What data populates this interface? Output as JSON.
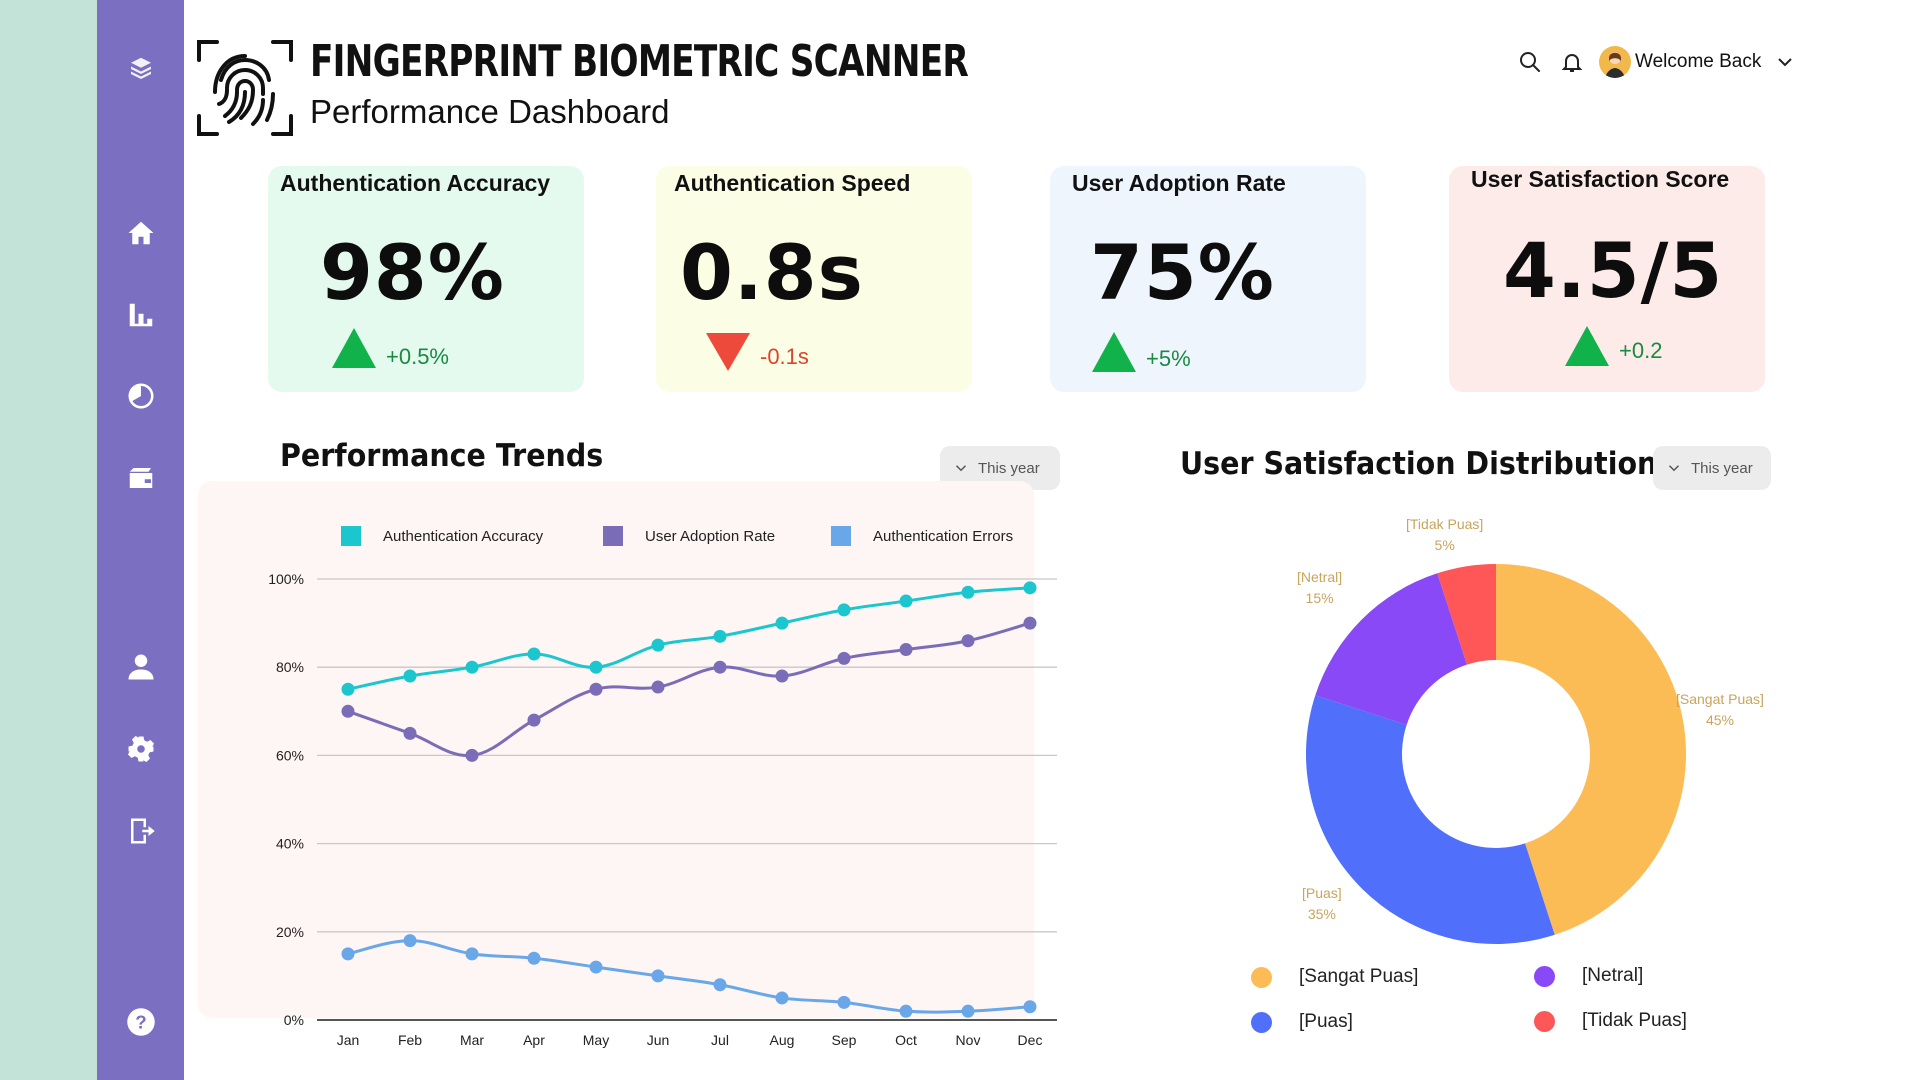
{
  "header": {
    "title": "FINGERPRINT BIOMETRIC SCANNER",
    "subtitle": "Performance Dashboard",
    "welcome": "Welcome Back"
  },
  "sidebar": {
    "items": [
      {
        "icon": "layers-logo-icon"
      },
      {
        "icon": "home-icon"
      },
      {
        "icon": "bar-chart-icon"
      },
      {
        "icon": "pie-chart-icon"
      },
      {
        "icon": "wallet-icon"
      },
      {
        "icon": "user-icon"
      },
      {
        "icon": "gear-icon"
      },
      {
        "icon": "logout-icon"
      },
      {
        "icon": "help-icon"
      }
    ]
  },
  "kpis": [
    {
      "title": "Authentication Accuracy",
      "value": "98%",
      "change": "+0.5%",
      "direction": "up",
      "bg": "#e4faee"
    },
    {
      "title": "Authentication Speed",
      "value": "0.8s",
      "change": "-0.1s",
      "direction": "down",
      "bg": "#fbfde4"
    },
    {
      "title": "User Adoption Rate",
      "value": "75%",
      "change": "+5%",
      "direction": "up",
      "bg": "#eef5fd"
    },
    {
      "title": "User Satisfaction Score",
      "value": "4.5/5",
      "change": "+0.2",
      "direction": "up",
      "bg": "#fdebe9"
    }
  ],
  "colors": {
    "up": "#12b24a",
    "down": "#ee4a3c",
    "up_text": "#1a8a43",
    "down_text": "#d9452f"
  },
  "trends": {
    "title": "Performance Trends",
    "filter": "This year"
  },
  "distribution": {
    "title": "User Satisfaction Distribution",
    "filter": "This year"
  },
  "chart_data": [
    {
      "type": "line",
      "x": [
        "Jan",
        "Feb",
        "Mar",
        "Apr",
        "May",
        "Jun",
        "Jul",
        "Aug",
        "Sep",
        "Oct",
        "Nov",
        "Dec"
      ],
      "yticks": [
        "0%",
        "20%",
        "40%",
        "60%",
        "80%",
        "100%"
      ],
      "ylim": [
        0,
        100
      ],
      "grid": true,
      "legend_position": "top",
      "series": [
        {
          "name": "Authentication Accuracy",
          "color": "#1cc6cf",
          "values": [
            75,
            78,
            80,
            83,
            80,
            85,
            87,
            90,
            93,
            95,
            97,
            98
          ]
        },
        {
          "name": "User Adoption Rate",
          "color": "#7b6cb8",
          "values": [
            70,
            65,
            60,
            68,
            75,
            75.5,
            80,
            78,
            82,
            84,
            86,
            90
          ]
        },
        {
          "name": "Authentication Errors",
          "color": "#6aa7e8",
          "values": [
            15,
            18,
            15,
            14,
            12,
            10,
            8,
            5,
            4,
            2,
            2,
            3
          ]
        }
      ]
    },
    {
      "type": "pie",
      "style": "donut",
      "slices": [
        {
          "label": "[Sangat Puas]",
          "value": 45,
          "display": "45%",
          "color": "#fbbc55"
        },
        {
          "label": "[Puas]",
          "value": 35,
          "display": "35%",
          "color": "#506ffb"
        },
        {
          "label": "[Netral]",
          "value": 15,
          "display": "15%",
          "color": "#8a49f6"
        },
        {
          "label": "[Tidak Puas]",
          "value": 5,
          "display": "5%",
          "color": "#ff5757"
        }
      ]
    }
  ]
}
